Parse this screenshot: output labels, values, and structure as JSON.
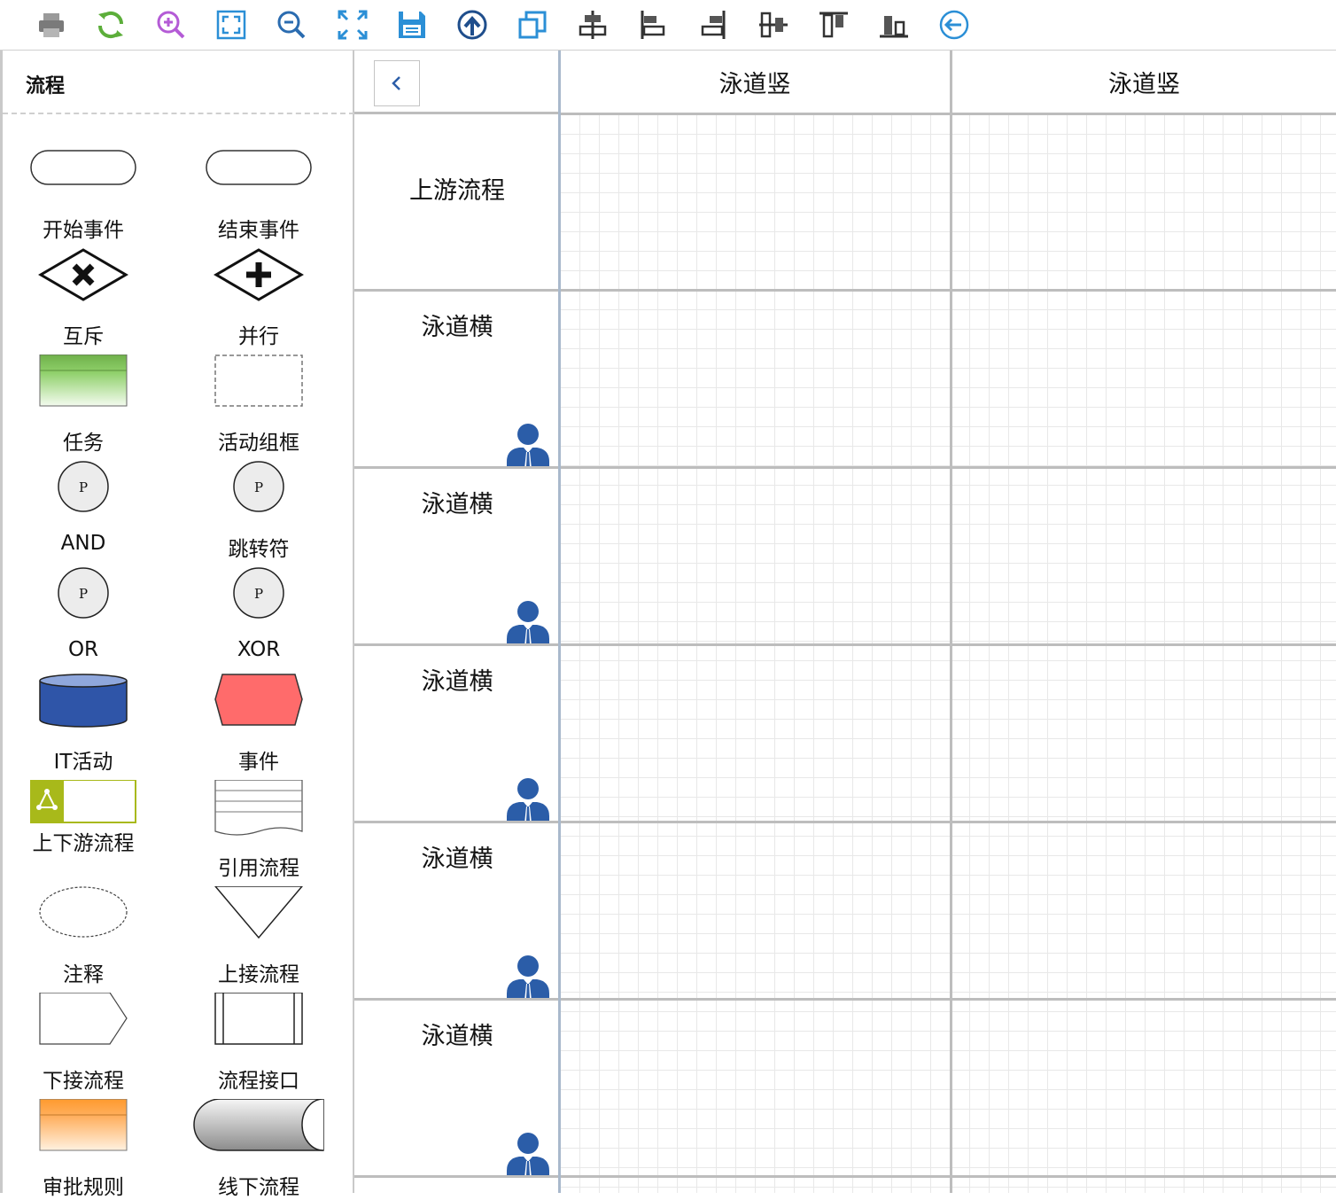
{
  "toolbar": {
    "icons": [
      "print-icon",
      "refresh-icon",
      "zoom-in-icon",
      "fit-icon",
      "zoom-out-icon",
      "fullscreen-icon",
      "save-icon",
      "upload-icon",
      "copy-icon",
      "align-center-icon",
      "align-left-icon",
      "align-right-icon",
      "align-middle-icon",
      "align-top-icon",
      "align-bottom-icon",
      "back-icon"
    ]
  },
  "sidebar": {
    "title": "流程",
    "items": [
      {
        "label": "开始事件"
      },
      {
        "label": "结束事件"
      },
      {
        "label": "互斥"
      },
      {
        "label": "并行"
      },
      {
        "label": "任务"
      },
      {
        "label": "活动组框"
      },
      {
        "label": "AND",
        "badge": "P"
      },
      {
        "label": "跳转符",
        "badge": "P"
      },
      {
        "label": "OR",
        "badge": "P"
      },
      {
        "label": "XOR",
        "badge": "P"
      },
      {
        "label": "IT活动"
      },
      {
        "label": "事件"
      },
      {
        "label": "上下游流程"
      },
      {
        "label": "引用流程"
      },
      {
        "label": "注释"
      },
      {
        "label": "上接流程"
      },
      {
        "label": "下接流程"
      },
      {
        "label": "流程接口"
      },
      {
        "label": "审批规则"
      },
      {
        "label": "线下流程"
      }
    ]
  },
  "canvas": {
    "columns": [
      "泳道竖",
      "泳道竖"
    ],
    "rows": [
      "上游流程",
      "泳道横",
      "泳道横",
      "泳道横",
      "泳道横",
      "泳道横"
    ]
  },
  "colors": {
    "accent": "#2b5da8",
    "task_green": "#6fb04a",
    "event_red": "#ff6b6b",
    "it_blue": "#2f55a8",
    "approval_orange": "#ff9a2e",
    "upstream_olive": "#a8b91a"
  }
}
